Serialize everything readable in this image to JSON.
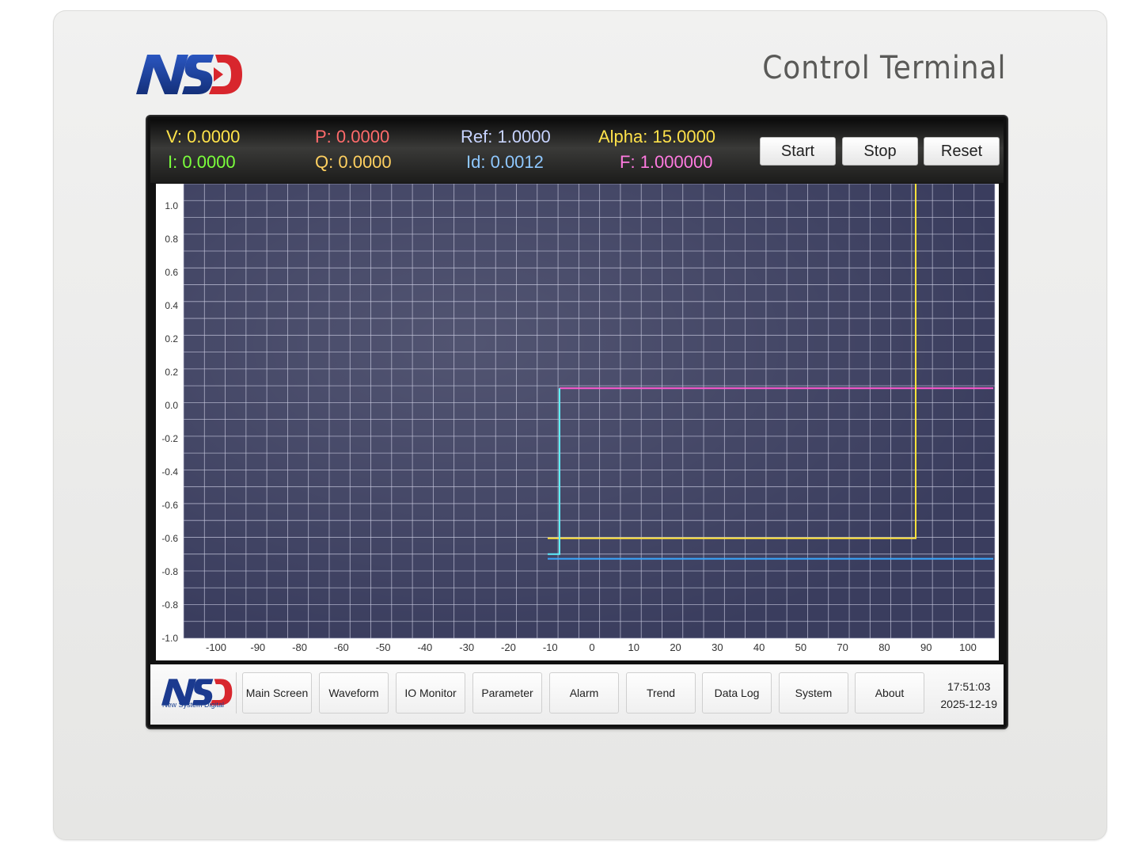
{
  "device": {
    "brand": "NSD",
    "title": "Control Terminal"
  },
  "readouts": [
    {
      "label": "V:",
      "value": "0.0000",
      "color": "#ffe34a"
    },
    {
      "label": "I:",
      "value": "0.0000",
      "color": "#7bff3c"
    },
    {
      "label": "P:",
      "value": "0.0000",
      "color": "#ff6b6b"
    },
    {
      "label": "Q:",
      "value": "0.0000",
      "color": "#ffd060"
    },
    {
      "label": "Ref:",
      "value": "1.0000",
      "color": "#c8d4ff"
    },
    {
      "label": "Id:",
      "value": "0.0012",
      "color": "#8fc8ff"
    },
    {
      "label": "Alpha:",
      "value": "15.0000",
      "color": "#ffe24a"
    },
    {
      "label": "F:",
      "value": "1.000000",
      "color": "#ff7ae0"
    }
  ],
  "controls": {
    "start": "Start",
    "stop": "Stop",
    "reset": "Reset"
  },
  "chart_data": {
    "type": "line",
    "title": "",
    "xlabel": "",
    "ylabel": "",
    "x_tick_labels": [
      "-100",
      "-90",
      "-80",
      "-60",
      "-50",
      "-40",
      "-30",
      "-20",
      "-10",
      "0",
      "10",
      "20",
      "30",
      "40",
      "50",
      "70",
      "80",
      "90",
      "100"
    ],
    "y_tick_labels": [
      "1.0",
      "0.8",
      "0.6",
      "0.4",
      "0.2",
      "0.2",
      "0.0",
      "-0.2",
      "-0.4",
      "-0.6",
      "-0.6",
      "-0.8",
      "-0.8",
      "-1.0"
    ],
    "xlim": [
      -105,
      100
    ],
    "ylim": [
      -1.0,
      1.0
    ],
    "grid": true,
    "background": "#3a3d5e",
    "series": [
      {
        "color": "#ff5ad2",
        "points": [
          [
            -10,
            0.1
          ],
          [
            100,
            0.1
          ]
        ]
      },
      {
        "color": "#ffe23a",
        "points": [
          [
            -13,
            -0.56
          ],
          [
            80,
            -0.56
          ],
          [
            80,
            1.2
          ]
        ]
      },
      {
        "color": "#3aa8ff",
        "points": [
          [
            -13,
            -0.65
          ],
          [
            100,
            -0.65
          ]
        ]
      },
      {
        "color": "#5ff0ff",
        "points": [
          [
            -13,
            -0.63
          ],
          [
            -10,
            -0.63
          ],
          [
            -10,
            0.1
          ]
        ]
      }
    ]
  },
  "nav": {
    "logo_text": "NSD",
    "logo_subtitle": "New System Digital",
    "items": [
      "Main Screen",
      "Waveform",
      "IO Monitor",
      "Parameter",
      "Alarm",
      "Trend",
      "Data Log",
      "System",
      "About"
    ]
  },
  "clock": {
    "time": "17:51:03",
    "date": "2025-12-19"
  },
  "colors": {
    "logo_blue": "#1b3a8f",
    "logo_red": "#d8262d"
  }
}
